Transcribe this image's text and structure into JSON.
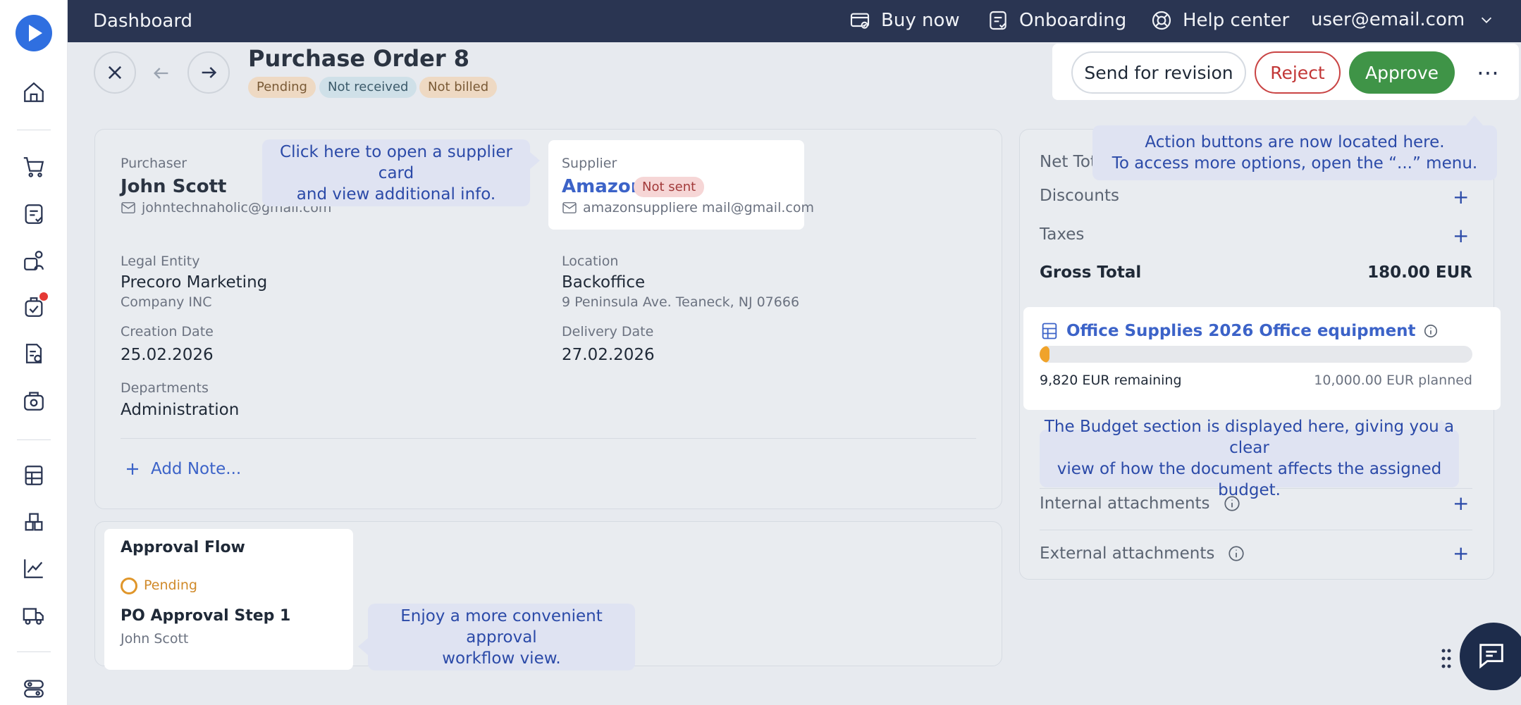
{
  "topbar": {
    "title": "Dashboard",
    "buy_now": "Buy now",
    "onboarding": "Onboarding",
    "help_center": "Help center",
    "user": "user@email.com"
  },
  "header": {
    "title": "Purchase Order 8",
    "badges": [
      "Pending",
      "Not received",
      "Not billed"
    ]
  },
  "actions": {
    "send_for_revision": "Send for revision",
    "reject": "Reject",
    "approve": "Approve",
    "more": "⋯"
  },
  "details": {
    "purchaser_label": "Purchaser",
    "purchaser_name": "John Scott",
    "purchaser_email": "johntechnaholic@gmail.com",
    "supplier_label": "Supplier",
    "supplier_name": "Amazon",
    "supplier_status": "Not sent",
    "supplier_email": "amazonsuppliere mail@gmail.com",
    "legal_entity_label": "Legal Entity",
    "legal_entity": "Precoro Marketing",
    "legal_entity_sub": "Company INC",
    "location_label": "Location",
    "location": "Backoffice",
    "location_address": "9 Peninsula Ave. Teaneck, NJ 07666",
    "creation_date_label": "Creation Date",
    "creation_date": "25.02.2026",
    "delivery_date_label": "Delivery Date",
    "delivery_date": "27.02.2026",
    "departments_label": "Departments",
    "departments": "Administration",
    "add_note": "Add Note..."
  },
  "approval": {
    "title": "Approval Flow",
    "status": "Pending",
    "step": "PO Approval Step 1",
    "approver": "John Scott"
  },
  "totals": {
    "net_total": "Net Tot",
    "discounts": "Discounts",
    "taxes": "Taxes",
    "gross_total_label": "Gross Total",
    "gross_total": "180.00 EUR"
  },
  "budget": {
    "name": "Office Supplies 2026 Office equipment",
    "remaining": "9,820 EUR remaining",
    "planned": "10,000.00 EUR planned",
    "progress": 0.018
  },
  "attachments": {
    "internal": "Internal attachments",
    "external": "External attachments"
  },
  "tips": {
    "supplier_line1": "Click here to open a supplier card",
    "supplier_line2": "and view additional info.",
    "actions_line1": "Action buttons are now located here.",
    "actions_line2": "To access more options, open the “...” menu.",
    "budget_line1": "The Budget section is displayed here, giving you a clear",
    "budget_line2": "view of how the document affects the assigned budget.",
    "approval_line1": "Enjoy a more convenient approval",
    "approval_line2": "workflow view."
  }
}
